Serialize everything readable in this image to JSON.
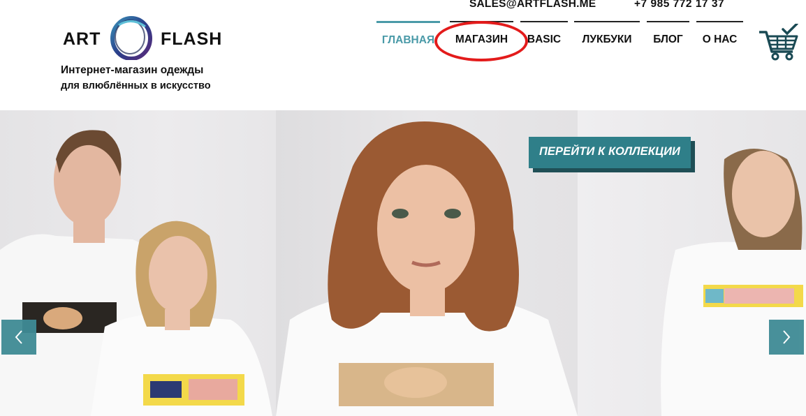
{
  "brand": {
    "logo_left": "ART",
    "logo_right": "FLASH",
    "tagline_line1": "Интернет-магазин одежды",
    "tagline_line2": "для влюблённых в искусство"
  },
  "contacts": {
    "email": "SALES@ARTFLASH.ME",
    "phone": "+7 985 772 17 37"
  },
  "nav": {
    "items": [
      {
        "label": "ГЛАВНАЯ",
        "active": true
      },
      {
        "label": "МАГАЗИН",
        "active": false
      },
      {
        "label": "BASIC",
        "active": false
      },
      {
        "label": "ЛУКБУКИ",
        "active": false
      },
      {
        "label": "БЛОГ",
        "active": false
      },
      {
        "label": "О НАС",
        "active": false
      }
    ],
    "highlighted_item": "МАГАЗИН"
  },
  "hero": {
    "cta_label": "ПЕРЕЙТИ К КОЛЛЕКЦИИ"
  },
  "icons": {
    "cart": "cart-icon",
    "prev": "chevron-left-icon",
    "next": "chevron-right-icon",
    "logo": "logo-ring-icon"
  },
  "colors": {
    "accent": "#4a9aa8",
    "cta_bg": "#2f7f89",
    "cta_shadow": "#1f4f56",
    "highlight_circle": "#e31b1b"
  }
}
